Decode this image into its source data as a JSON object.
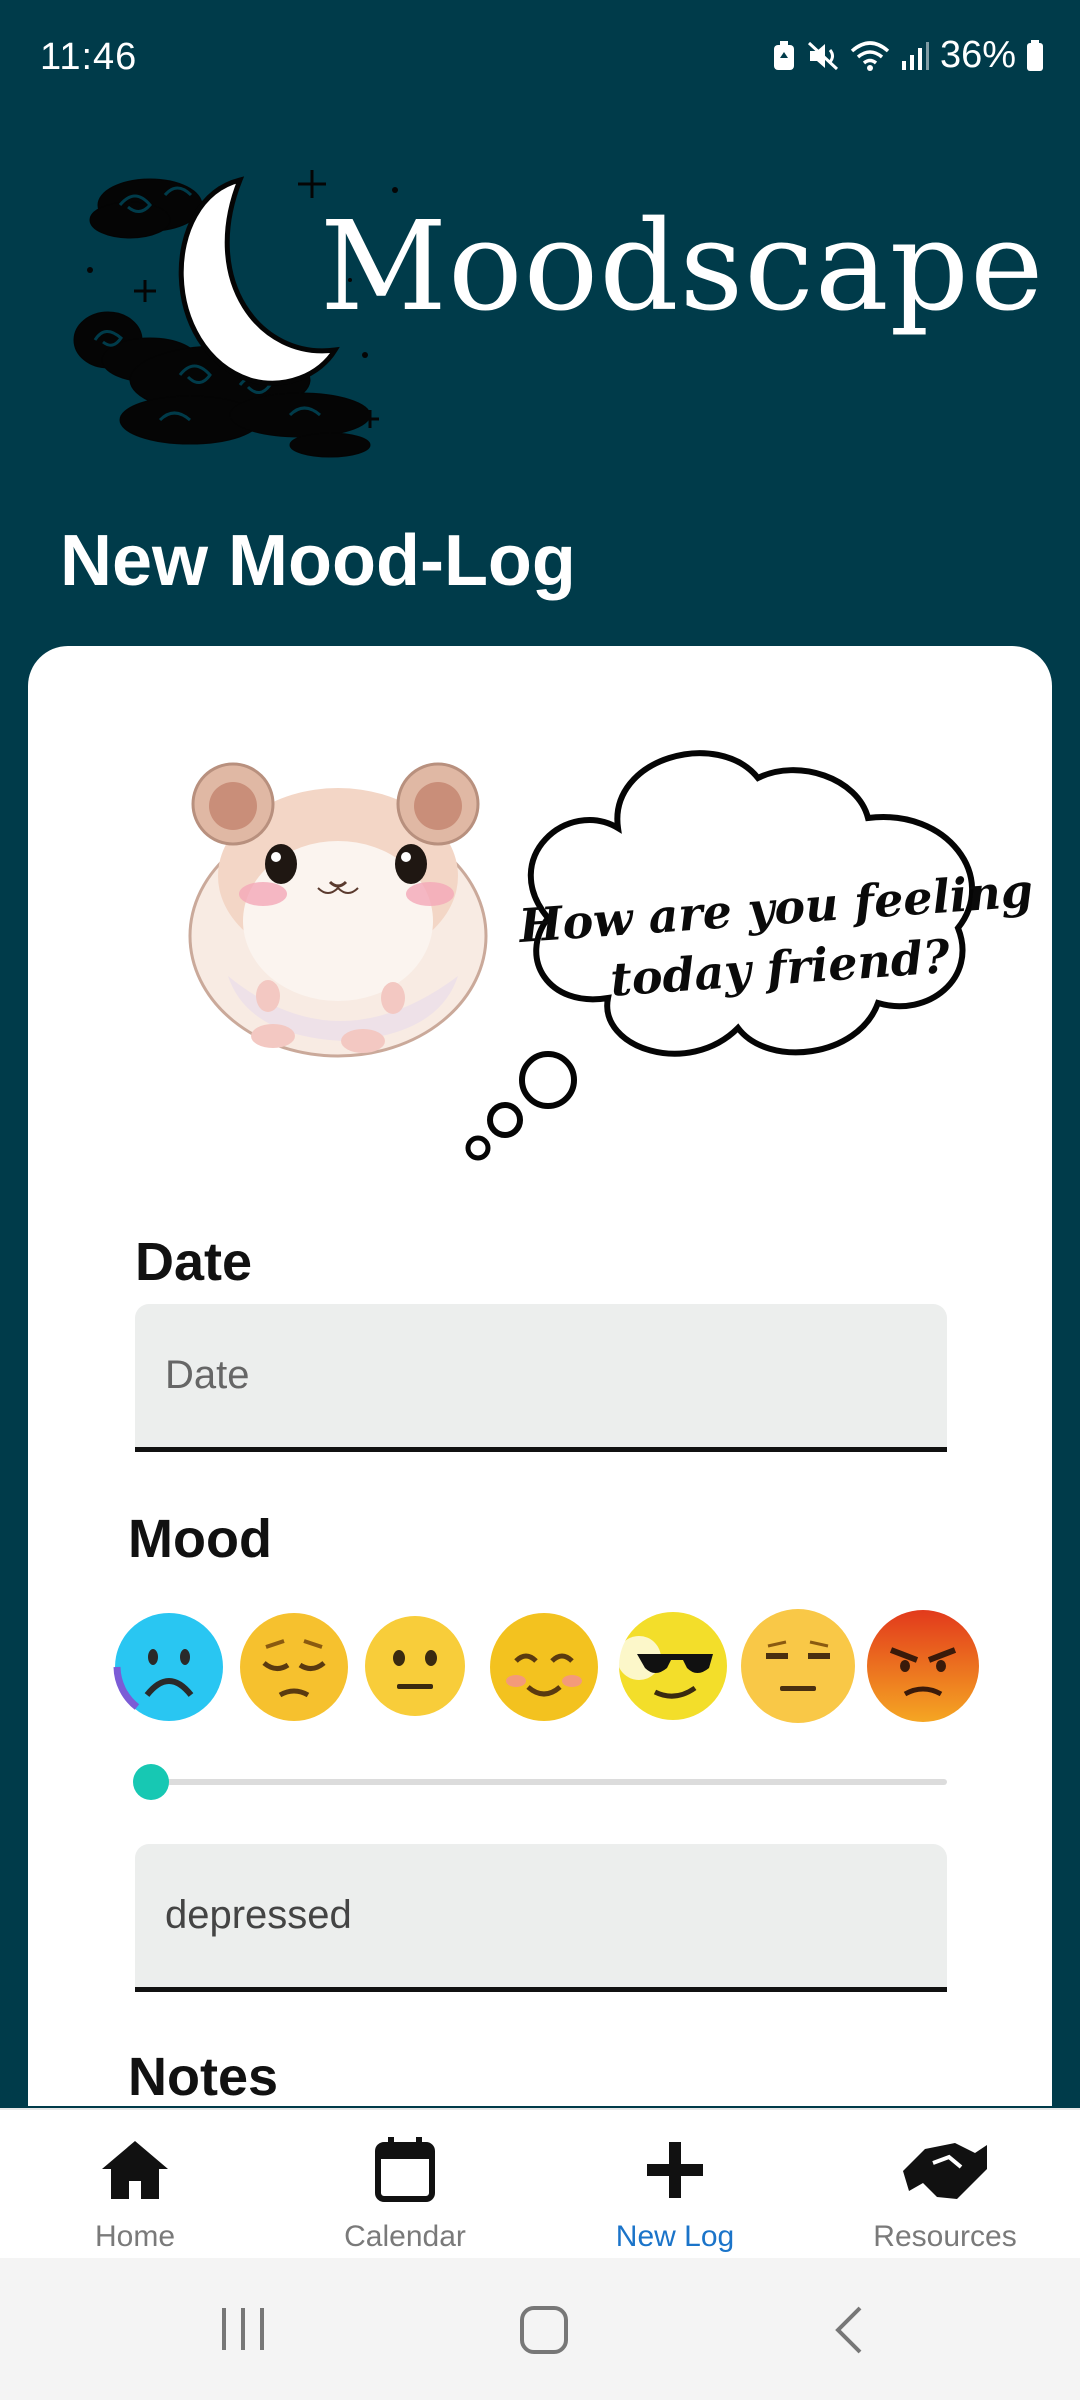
{
  "status_bar": {
    "time": "11:46",
    "battery": "36%",
    "icons": [
      "battery-saver-icon",
      "mute-icon",
      "wifi-icon",
      "signal-icon",
      "battery-icon"
    ]
  },
  "header": {
    "app_name": "Moodscape",
    "logo_icon": "crescent-moon-clouds-icon"
  },
  "page": {
    "title": "New Mood-Log"
  },
  "mascot": {
    "speech_line1": "How are you feeling",
    "speech_line2": "today friend?"
  },
  "form": {
    "date": {
      "label": "Date",
      "placeholder": "Date",
      "value": ""
    },
    "mood": {
      "label": "Mood",
      "options": [
        {
          "icon": "sad-face-icon",
          "color": "#29c6f2"
        },
        {
          "icon": "pensive-face-icon",
          "color": "#f6c12e"
        },
        {
          "icon": "neutral-face-icon",
          "color": "#f8cd3a"
        },
        {
          "icon": "smiling-face-icon",
          "color": "#f3c21f"
        },
        {
          "icon": "cool-sunglasses-face-icon",
          "color": "#f3de2a"
        },
        {
          "icon": "unamused-face-icon",
          "color": "#f9c847"
        },
        {
          "icon": "angry-face-icon",
          "color": "#e8541e"
        }
      ],
      "slider_level": 0,
      "value": "depressed"
    },
    "notes": {
      "label": "Notes"
    }
  },
  "bottom_nav": {
    "items": [
      {
        "label": "Home",
        "icon": "home-icon"
      },
      {
        "label": "Calendar",
        "icon": "calendar-icon"
      },
      {
        "label": "New Log",
        "icon": "plus-icon",
        "active": true
      },
      {
        "label": "Resources",
        "icon": "handshake-icon"
      }
    ],
    "active_color": "#1b74c9"
  },
  "colors": {
    "background": "#003b4a",
    "slider_thumb": "#17c8b3"
  }
}
